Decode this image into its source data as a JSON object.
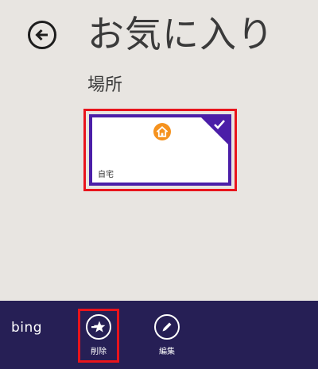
{
  "header": {
    "title": "お気に入り"
  },
  "section": {
    "title": "場所"
  },
  "tile": {
    "label": "自宅",
    "selected": true,
    "icon": "home-icon",
    "border_color": "#4b1ea8",
    "icon_color": "#f5921e"
  },
  "app_bar": {
    "brand": "bing",
    "background": "#261f55",
    "buttons": [
      {
        "label": "削除",
        "icon": "favorite-remove-icon"
      },
      {
        "label": "編集",
        "icon": "pencil-icon"
      }
    ]
  },
  "highlight_color": "#e8141c"
}
